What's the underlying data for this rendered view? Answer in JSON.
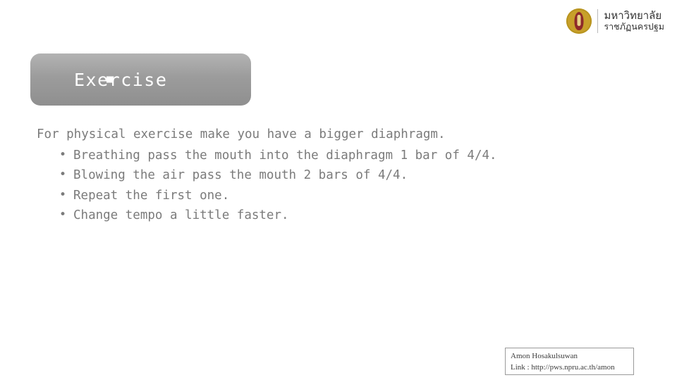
{
  "logo": {
    "line1": "มหาวิทยาลัย",
    "line2": "ราชภัฏนครปฐม",
    "seal_name": "university-seal-icon"
  },
  "slide": {
    "title": "Exercise",
    "bullet_marker": "square-bullet-icon",
    "lead": "For physical exercise make you have a bigger diaphragm.",
    "bullets": [
      "Breathing pass the mouth into the diaphragm 1 bar of 4/4.",
      "Blowing the air pass the mouth 2 bars of 4/4.",
      "Repeat the first one.",
      "Change tempo a little faster."
    ],
    "bullet_glyph": "•"
  },
  "credit": {
    "author": "Amon Hosakulsuwan",
    "link": "Link : http://pws.npru.ac.th/amon"
  },
  "colors": {
    "banner_gray": "#9c9c9c",
    "body_text": "#7b7b7b",
    "seal_gold": "#c8a02a"
  }
}
